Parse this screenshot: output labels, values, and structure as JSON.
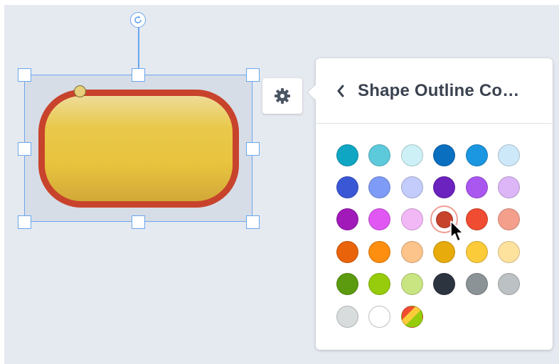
{
  "panel": {
    "title": "Shape Outline Co…",
    "back_icon": "chevron-left-icon"
  },
  "toolbar": {
    "settings_icon": "gear-icon"
  },
  "canvas": {
    "background": "#e5e9f0",
    "selection_color": "#6aa6ee"
  },
  "shape": {
    "type": "rounded-rectangle",
    "fill_top": "#eedc98",
    "fill_bottom": "#d2a838",
    "outline_color": "#c8432c"
  },
  "swatches": [
    {
      "name": "teal",
      "color": "#0fa6c4",
      "row": 0,
      "col": 0
    },
    {
      "name": "teal-light",
      "color": "#5ccadb",
      "row": 0,
      "col": 1
    },
    {
      "name": "teal-pale",
      "color": "#ccf0f5",
      "row": 0,
      "col": 2
    },
    {
      "name": "blue-dark",
      "color": "#0b6fbf",
      "row": 0,
      "col": 3
    },
    {
      "name": "blue",
      "color": "#1b96e0",
      "row": 0,
      "col": 4
    },
    {
      "name": "blue-pale",
      "color": "#cde8f8",
      "row": 0,
      "col": 5
    },
    {
      "name": "indigo",
      "color": "#3a57d6",
      "row": 1,
      "col": 0
    },
    {
      "name": "periwinkle",
      "color": "#7e9bf7",
      "row": 1,
      "col": 1
    },
    {
      "name": "periwinkle-pale",
      "color": "#c3ccfa",
      "row": 1,
      "col": 2
    },
    {
      "name": "violet",
      "color": "#6b22be",
      "row": 1,
      "col": 3
    },
    {
      "name": "purple",
      "color": "#a957ef",
      "row": 1,
      "col": 4
    },
    {
      "name": "lavender",
      "color": "#dcb6f6",
      "row": 1,
      "col": 5
    },
    {
      "name": "magenta-dark",
      "color": "#a11ab9",
      "row": 2,
      "col": 0
    },
    {
      "name": "magenta",
      "color": "#e057f3",
      "row": 2,
      "col": 1
    },
    {
      "name": "pink-pale",
      "color": "#f2b8f5",
      "row": 2,
      "col": 2
    },
    {
      "name": "red-dark",
      "color": "#c8432c",
      "row": 2,
      "col": 3,
      "selected": true
    },
    {
      "name": "red-orange",
      "color": "#f04c31",
      "row": 2,
      "col": 4
    },
    {
      "name": "salmon",
      "color": "#f49f8c",
      "row": 2,
      "col": 5
    },
    {
      "name": "orange-dark",
      "color": "#e9630b",
      "row": 3,
      "col": 0
    },
    {
      "name": "orange",
      "color": "#fd8e10",
      "row": 3,
      "col": 1
    },
    {
      "name": "peach",
      "color": "#fcc38b",
      "row": 3,
      "col": 2
    },
    {
      "name": "gold",
      "color": "#e7ac0c",
      "row": 3,
      "col": 3
    },
    {
      "name": "yellow",
      "color": "#fbcb3a",
      "row": 3,
      "col": 4
    },
    {
      "name": "yellow-pale",
      "color": "#fde29d",
      "row": 3,
      "col": 5
    },
    {
      "name": "green-dark",
      "color": "#5c9a0f",
      "row": 4,
      "col": 0
    },
    {
      "name": "lime",
      "color": "#97cc0c",
      "row": 4,
      "col": 1
    },
    {
      "name": "lime-pale",
      "color": "#c8e582",
      "row": 4,
      "col": 2
    },
    {
      "name": "charcoal",
      "color": "#2c3440",
      "row": 4,
      "col": 3
    },
    {
      "name": "gray",
      "color": "#8b9397",
      "row": 4,
      "col": 4
    },
    {
      "name": "gray-light",
      "color": "#bcc1c3",
      "row": 4,
      "col": 5
    },
    {
      "name": "gray-pale",
      "color": "#d8dcdd",
      "row": 5,
      "col": 0
    },
    {
      "name": "white",
      "color": "#ffffff",
      "row": 5,
      "col": 1
    },
    {
      "name": "multicolor",
      "color": "multi",
      "row": 5,
      "col": 2
    }
  ]
}
